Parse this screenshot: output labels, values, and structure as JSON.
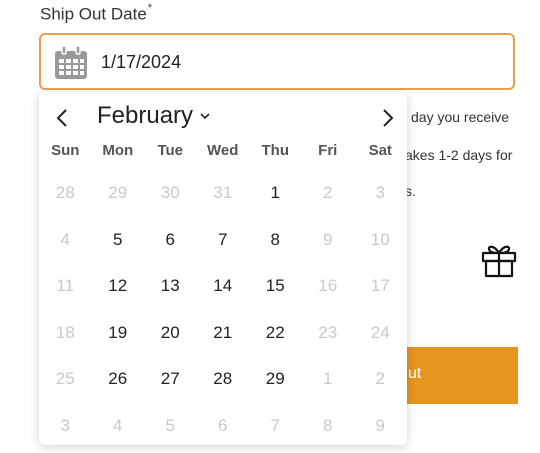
{
  "field": {
    "label": "Ship Out Date",
    "required_mark": "*",
    "value": "1/17/2024"
  },
  "background": {
    "text1": "day you receive",
    "text2": "akes 1-2 days for",
    "text3": "s.",
    "button_label": "ut"
  },
  "calendar": {
    "month": "February",
    "weekdays": [
      "Sun",
      "Mon",
      "Tue",
      "Wed",
      "Thu",
      "Fri",
      "Sat"
    ],
    "weeks": [
      [
        {
          "d": "28",
          "m": true
        },
        {
          "d": "29",
          "m": true
        },
        {
          "d": "30",
          "m": true
        },
        {
          "d": "31",
          "m": true
        },
        {
          "d": "1",
          "m": false
        },
        {
          "d": "2",
          "m": true
        },
        {
          "d": "3",
          "m": true
        }
      ],
      [
        {
          "d": "4",
          "m": true
        },
        {
          "d": "5",
          "m": false
        },
        {
          "d": "6",
          "m": false
        },
        {
          "d": "7",
          "m": false
        },
        {
          "d": "8",
          "m": false
        },
        {
          "d": "9",
          "m": true
        },
        {
          "d": "10",
          "m": true
        }
      ],
      [
        {
          "d": "11",
          "m": true
        },
        {
          "d": "12",
          "m": false
        },
        {
          "d": "13",
          "m": false
        },
        {
          "d": "14",
          "m": false
        },
        {
          "d": "15",
          "m": false
        },
        {
          "d": "16",
          "m": true
        },
        {
          "d": "17",
          "m": true
        }
      ],
      [
        {
          "d": "18",
          "m": true
        },
        {
          "d": "19",
          "m": false
        },
        {
          "d": "20",
          "m": false
        },
        {
          "d": "21",
          "m": false
        },
        {
          "d": "22",
          "m": false
        },
        {
          "d": "23",
          "m": true
        },
        {
          "d": "24",
          "m": true
        }
      ],
      [
        {
          "d": "25",
          "m": true
        },
        {
          "d": "26",
          "m": false
        },
        {
          "d": "27",
          "m": false
        },
        {
          "d": "28",
          "m": false
        },
        {
          "d": "29",
          "m": false
        },
        {
          "d": "1",
          "m": true
        },
        {
          "d": "2",
          "m": true
        }
      ],
      [
        {
          "d": "3",
          "m": true
        },
        {
          "d": "4",
          "m": true
        },
        {
          "d": "5",
          "m": true
        },
        {
          "d": "6",
          "m": true
        },
        {
          "d": "7",
          "m": true
        },
        {
          "d": "8",
          "m": true
        },
        {
          "d": "9",
          "m": true
        }
      ]
    ]
  },
  "colors": {
    "accent_border": "#e8a050",
    "button_bg": "#e8951f",
    "muted_day": "#c9c9c9"
  },
  "icons": {
    "calendar": "calendar-icon",
    "prev": "chevron-left-icon",
    "next": "chevron-right-icon",
    "month_dropdown": "chevron-down-icon",
    "gift": "gift-icon"
  }
}
